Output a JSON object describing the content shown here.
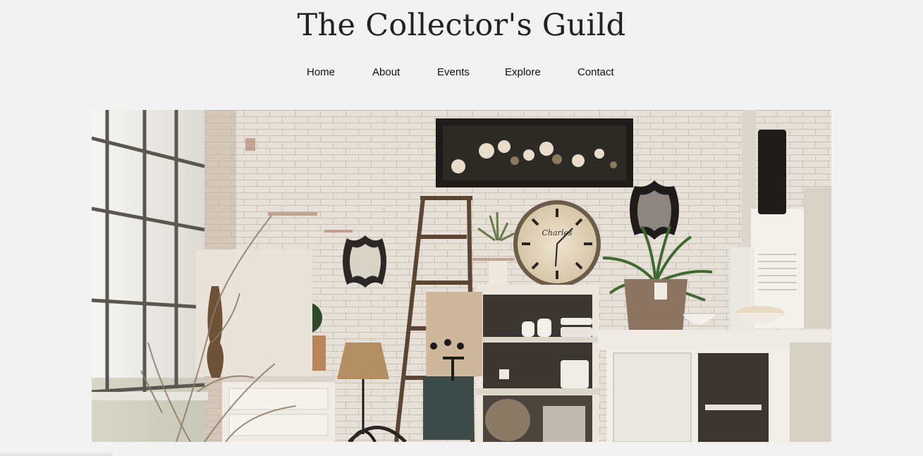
{
  "site": {
    "title": "The Collector's Guild"
  },
  "nav": {
    "items": [
      {
        "label": "Home"
      },
      {
        "label": "About"
      },
      {
        "label": "Events"
      },
      {
        "label": "Explore"
      },
      {
        "label": "Contact"
      }
    ]
  },
  "hero": {
    "clock_brand": "Charles"
  }
}
